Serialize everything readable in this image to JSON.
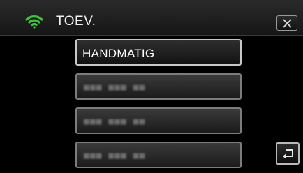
{
  "header": {
    "title": "TOEV.",
    "wifi_icon": "wifi-icon",
    "close_icon": "close-icon"
  },
  "list": {
    "items": [
      {
        "label": "HANDMATIG",
        "obscured": false
      },
      {
        "label": "",
        "obscured": true
      },
      {
        "label": "",
        "obscured": true
      },
      {
        "label": "",
        "obscured": true
      }
    ]
  },
  "footer": {
    "back_icon": "return-icon"
  },
  "colors": {
    "background": "#000000",
    "wifi": "#3cc43c",
    "text": "#ffffff"
  }
}
